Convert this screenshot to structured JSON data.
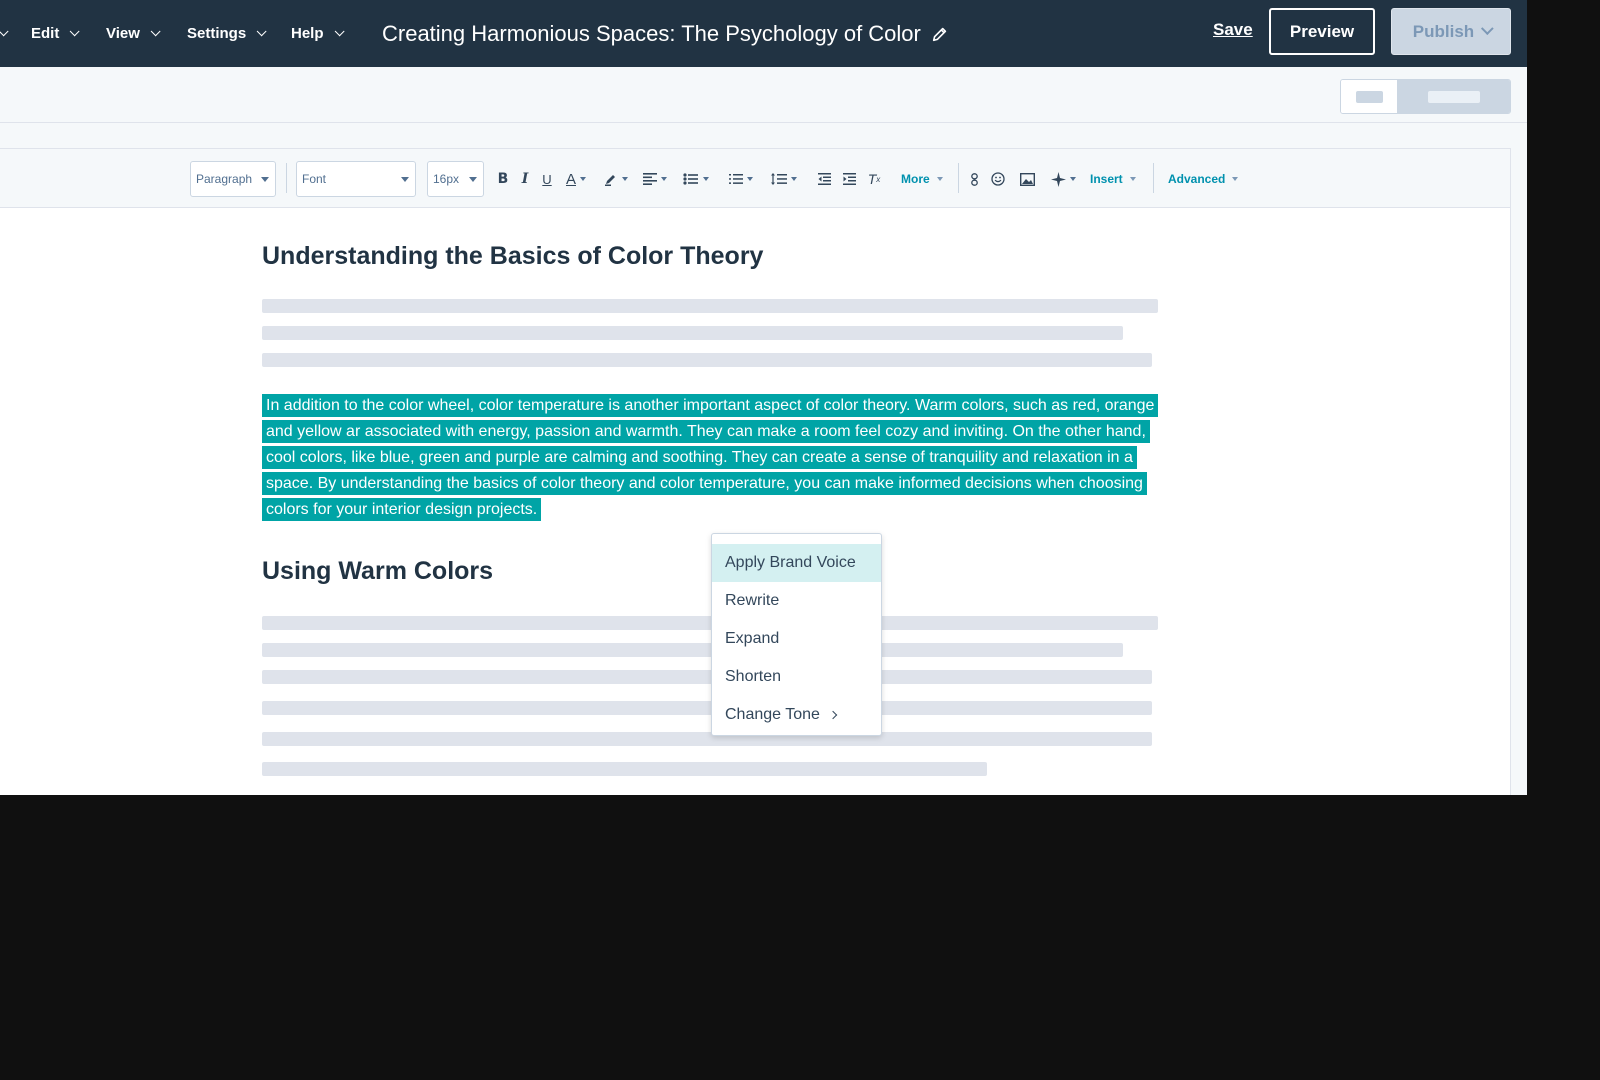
{
  "topbar": {
    "menus": [
      {
        "label": "Edit"
      },
      {
        "label": "View"
      },
      {
        "label": "Settings"
      },
      {
        "label": "Help"
      }
    ],
    "title": "Creating Harmonious Spaces: The Psychology of Color",
    "save_label": "Save",
    "preview_label": "Preview",
    "publish_label": "Publish"
  },
  "toolbar": {
    "paragraph": "Paragraph",
    "font": "Font",
    "size": "16px",
    "more": "More",
    "insert": "Insert",
    "advanced": "Advanced"
  },
  "content": {
    "heading1": "Understanding the Basics of Color Theory",
    "selected_paragraph": "In addition to the color wheel, color temperature is another important aspect of color theory. Warm colors, such as red, orange and yellow ar associated with energy, passion and warmth. They can make a room feel cozy and inviting. On the other hand, cool colors, like blue, green and purple are calming and soothing. They can create a sense of tranquility and relaxation in a space. By understanding the basics of color theory and color temperature, you can make informed decisions when choosing colors for your interior design projects.",
    "heading2": "Using Warm Colors"
  },
  "context_menu": {
    "items": [
      {
        "label": "Apply Brand Voice"
      },
      {
        "label": "Rewrite"
      },
      {
        "label": "Expand"
      },
      {
        "label": "Shorten"
      },
      {
        "label": "Change Tone"
      }
    ]
  },
  "colors": {
    "nav_bg": "#213343",
    "selection": "#00a4a6",
    "menu_highlight": "#d4f0f1",
    "placeholder": "#dfe3eb"
  }
}
